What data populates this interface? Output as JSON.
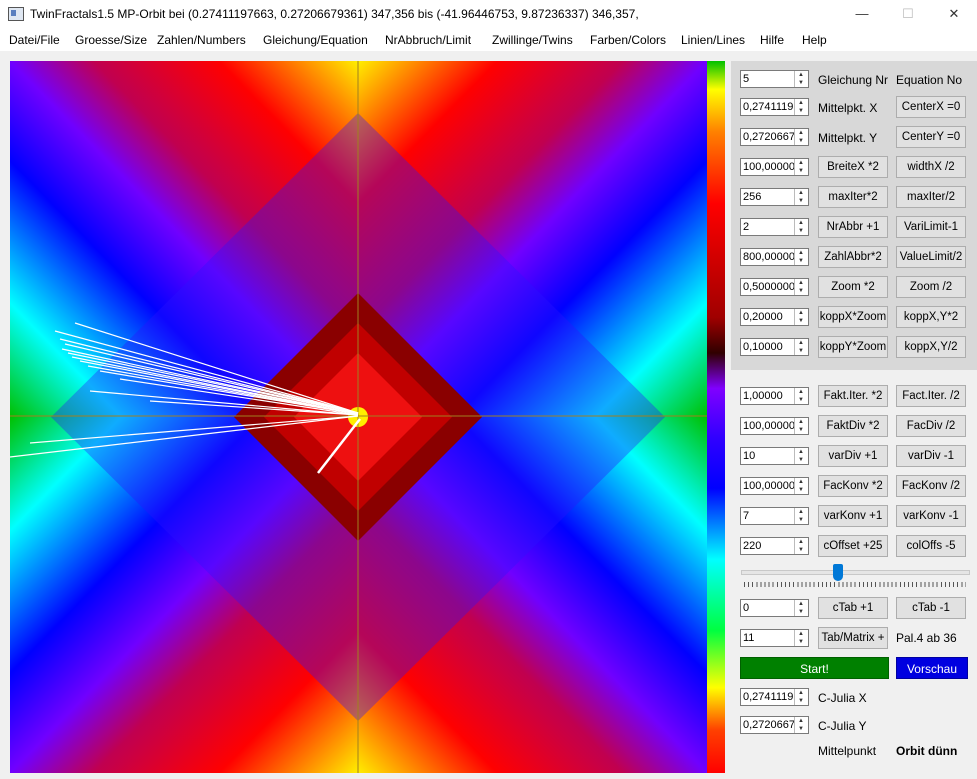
{
  "window": {
    "title": "TwinFractals1.5 MP-Orbit bei (0.27411197663, 0.27206679361) 347,356 bis (-41.96446753, 9.87236337) 346,357,",
    "minimize_glyph": "—",
    "maximize_glyph": "☐",
    "close_glyph": "✕"
  },
  "menu": [
    "Datei/File",
    "Groesse/Size",
    "Zahlen/Numbers",
    "Gleichung/Equation",
    "NrAbbruch/Limit",
    "Zwillinge/Twins",
    "Farben/Colors",
    "Linien/Lines",
    "Hilfe",
    "Help"
  ],
  "panel_top": [
    {
      "value": "5",
      "left": "Gleichung Nr",
      "right": "Equation No",
      "left_is_label": true,
      "right_is_label": true
    },
    {
      "value": "0,2741119",
      "left": "Mittelpkt. X",
      "right": "CenterX =0",
      "left_is_label": true
    },
    {
      "value": "0,2720667",
      "left": "Mittelpkt. Y",
      "right": "CenterY =0",
      "left_is_label": true
    },
    {
      "value": "100,00000",
      "left": "BreiteX *2",
      "right": "widthX /2"
    },
    {
      "value": "256",
      "left": "maxIter*2",
      "right": "maxIter/2"
    },
    {
      "value": "2",
      "left": "NrAbbr +1",
      "right": "VariLimit-1"
    },
    {
      "value": "800,00000",
      "left": "ZahlAbbr*2",
      "right": "ValueLimit/2"
    },
    {
      "value": "0,5000000",
      "left": "Zoom *2",
      "right": "Zoom /2"
    },
    {
      "value": "0,20000",
      "left": "koppX*Zoom",
      "right": "koppX,Y*2"
    },
    {
      "value": "0,10000",
      "left": "koppY*Zoom",
      "right": "koppX,Y/2"
    }
  ],
  "panel_bottom": [
    {
      "value": "1,00000",
      "left": "Fakt.Iter. *2",
      "right": "Fact.Iter. /2"
    },
    {
      "value": "100,00000",
      "left": "FaktDiv *2",
      "right": "FacDiv /2"
    },
    {
      "value": "10",
      "left": "varDiv +1",
      "right": "varDiv -1"
    },
    {
      "value": "100,00000",
      "left": "FacKonv *2",
      "right": "FacKonv /2"
    },
    {
      "value": "7",
      "left": "varKonv +1",
      "right": "varKonv -1"
    },
    {
      "value": "220",
      "left": "cOffset +25",
      "right": "colOffs -5"
    }
  ],
  "color_slider": {
    "position_fraction": 0.42
  },
  "ctab": {
    "value": "0",
    "left": "cTab +1",
    "right": "cTab -1"
  },
  "matrix": {
    "value": "11",
    "left": "Tab/Matrix +",
    "right": "Pal.4 ab 36"
  },
  "start_label": "Start!",
  "preview_label": "Vorschau",
  "julia": [
    {
      "value": "0,2741119",
      "label": "C-Julia X"
    },
    {
      "value": "0,2720667",
      "label": "C-Julia Y"
    }
  ],
  "status": {
    "left": "Mittelpunkt",
    "right": "Orbit dünn"
  },
  "colors": {
    "start": "#008000",
    "preview": "#0000e0",
    "axis": "#a08020",
    "orbit": "#ffffff"
  }
}
